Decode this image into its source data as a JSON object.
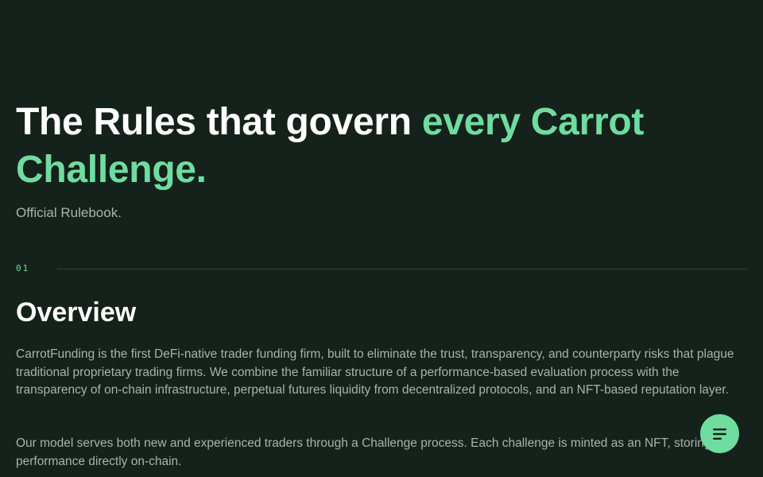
{
  "hero": {
    "title_plain": "The Rules that govern ",
    "title_accent": "every Carrot Challenge.",
    "subtitle": "Official Rulebook."
  },
  "section": {
    "index": "01",
    "title": "Overview",
    "paragraphs": [
      "CarrotFunding is the first DeFi-native trader funding firm, built to eliminate the trust, transparency, and counterparty risks that plague traditional proprietary trading firms. We combine the familiar structure of a performance-based evaluation process with the transparency of on-chain infrastructure, perpetual futures liquidity from decentralized protocols, and an NFT-based reputation layer.",
      "Our model serves both new and experienced traders through a Challenge process. Each challenge is minted as an NFT, storing its performance directly on-chain."
    ]
  },
  "fab": {
    "icon": "menu-lines-icon"
  },
  "colors": {
    "background": "#15221b",
    "accent": "#6fdca0",
    "body_text": "#a9b2ad",
    "divider": "#34443b"
  }
}
